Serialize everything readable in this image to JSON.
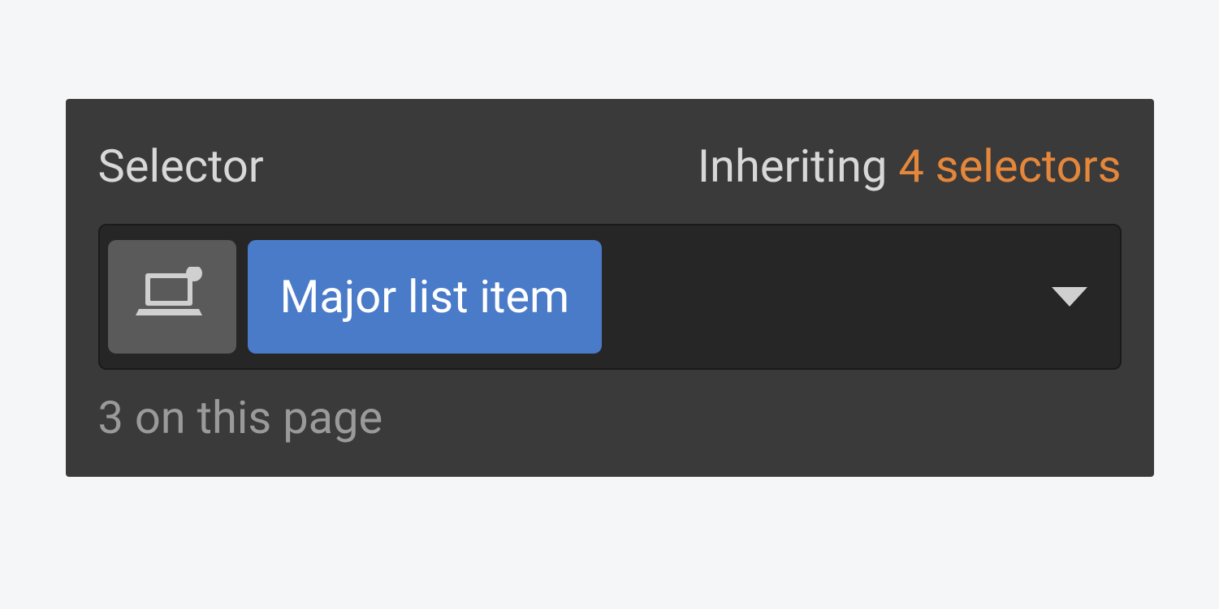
{
  "header": {
    "selector_label": "Selector",
    "inheriting_label": "Inheriting ",
    "inheriting_count": "4 selectors"
  },
  "selector_field": {
    "class_name": "Major list item"
  },
  "footer": {
    "count_text": "3 on this page"
  },
  "icons": {
    "breakpoint": "breakpoint-desktop-icon",
    "dropdown": "caret-down-icon"
  },
  "colors": {
    "panel_bg": "#3a3a3a",
    "field_bg": "#262626",
    "class_chip": "#4a7bc8",
    "accent_orange": "#e5873b"
  }
}
